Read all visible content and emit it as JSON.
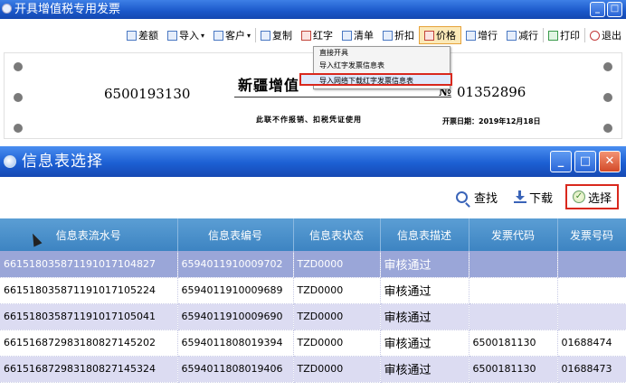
{
  "background_window": {
    "title": "开具增值税专用发票",
    "toolbar": [
      {
        "label": "差额",
        "icon": "difference-icon"
      },
      {
        "label": "导入",
        "icon": "import-icon",
        "dropdown": true
      },
      {
        "label": "客户",
        "icon": "customer-icon",
        "dropdown": true
      },
      {
        "label": "复制",
        "icon": "copy-icon"
      },
      {
        "label": "红字",
        "icon": "red-invoice-icon"
      },
      {
        "label": "清单",
        "icon": "list-icon"
      },
      {
        "label": "折扣",
        "icon": "discount-icon"
      },
      {
        "label": "价格",
        "icon": "price-icon"
      },
      {
        "label": "增行",
        "icon": "add-row-icon"
      },
      {
        "label": "减行",
        "icon": "remove-row-icon"
      },
      {
        "label": "打印",
        "icon": "print-icon"
      },
      {
        "label": "退出",
        "icon": "exit-icon"
      }
    ],
    "dropdown_menu": {
      "items": [
        "直接开具",
        "导入红字发票信息表",
        "导入网络下载红字发票信息表"
      ],
      "highlighted_index": 2
    },
    "invoice": {
      "code": "6500193130",
      "title": "新疆增值",
      "number_label": "№",
      "number": "01352896",
      "note": "此联不作报销、扣税凭证使用",
      "date": "开票日期：2019年12月18日"
    }
  },
  "dialog": {
    "title": "信息表选择",
    "toolbar": {
      "search_label": "查找",
      "download_label": "下载",
      "select_label": "选择"
    },
    "columns": [
      "信息表流水号",
      "信息表编号",
      "信息表状态",
      "信息表描述",
      "发票代码",
      "发票号码"
    ],
    "rows": [
      [
        "661518035871191017104827",
        "6594011910009702",
        "TZD0000",
        "审核通过",
        "",
        ""
      ],
      [
        "661518035871191017105224",
        "6594011910009689",
        "TZD0000",
        "审核通过",
        "",
        ""
      ],
      [
        "661518035871191017105041",
        "6594011910009690",
        "TZD0000",
        "审核通过",
        "",
        ""
      ],
      [
        "661516872983180827145202",
        "6594011808019394",
        "TZD0000",
        "审核通过",
        "6500181130",
        "01688474"
      ],
      [
        "661516872983180827145324",
        "6594011808019406",
        "TZD0000",
        "审核通过",
        "6500181130",
        "01688473"
      ]
    ],
    "selected_row": 0
  }
}
